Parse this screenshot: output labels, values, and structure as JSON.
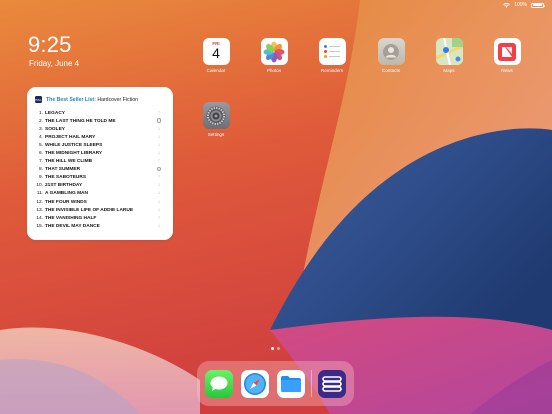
{
  "status_bar": {
    "battery_text": "100%",
    "battery_level": 1.0
  },
  "lock": {
    "time": "9:25",
    "date": "Friday, June 4"
  },
  "widget": {
    "logo_text": "BSL",
    "title_accent": "The Best Seller List:",
    "title_sub": "Hardcover Fiction",
    "books": [
      {
        "rank": "1.",
        "title": "LEGACY",
        "trend": "up"
      },
      {
        "rank": "2.",
        "title": "THE LAST THING HE TOLD ME",
        "trend": "same"
      },
      {
        "rank": "3.",
        "title": "SOOLEY",
        "trend": "down"
      },
      {
        "rank": "4.",
        "title": "PROJECT HAIL MARY",
        "trend": "down"
      },
      {
        "rank": "5.",
        "title": "WHILE JUSTICE SLEEPS",
        "trend": "down"
      },
      {
        "rank": "6.",
        "title": "THE MIDNIGHT LIBRARY",
        "trend": "down"
      },
      {
        "rank": "7.",
        "title": "THE HILL WE CLIMB",
        "trend": "up"
      },
      {
        "rank": "8.",
        "title": "THAT SUMMER",
        "trend": "same"
      },
      {
        "rank": "9.",
        "title": "THE SABOTEURS",
        "trend": "up"
      },
      {
        "rank": "10.",
        "title": "21ST BIRTHDAY",
        "trend": "down"
      },
      {
        "rank": "11.",
        "title": "A GAMBLING MAN",
        "trend": "down"
      },
      {
        "rank": "12.",
        "title": "THE FOUR WINDS",
        "trend": "down"
      },
      {
        "rank": "13.",
        "title": "THE INVISIBLE LIFE OF ADDIE LARUE",
        "trend": "down"
      },
      {
        "rank": "14.",
        "title": "THE VANISHING HALF",
        "trend": "up"
      },
      {
        "rank": "15.",
        "title": "THE DEVIL MAY DANCE",
        "trend": "down"
      }
    ]
  },
  "apps": {
    "calendar": {
      "label": "Calendar",
      "day": "FRI",
      "num": "4"
    },
    "photos": {
      "label": "Photos"
    },
    "reminders": {
      "label": "Reminders"
    },
    "contacts": {
      "label": "Contacts"
    },
    "maps": {
      "label": "Maps"
    },
    "news": {
      "label": "News"
    },
    "settings": {
      "label": "Settings"
    }
  },
  "dock": [
    "Messages",
    "Safari",
    "Files",
    "The Best Seller List"
  ],
  "pages": {
    "count": 2,
    "active": 0
  },
  "colors": {
    "wallpaper_orange": "#e8813a",
    "wallpaper_red": "#d8443a",
    "wallpaper_blue": "#2d4f8c",
    "wallpaper_magenta": "#c2478f",
    "widget_accent": "#1e8bb5"
  },
  "icons": {
    "trend_up": "↑",
    "trend_down": "↓",
    "trend_same": "unchanged-circle"
  }
}
